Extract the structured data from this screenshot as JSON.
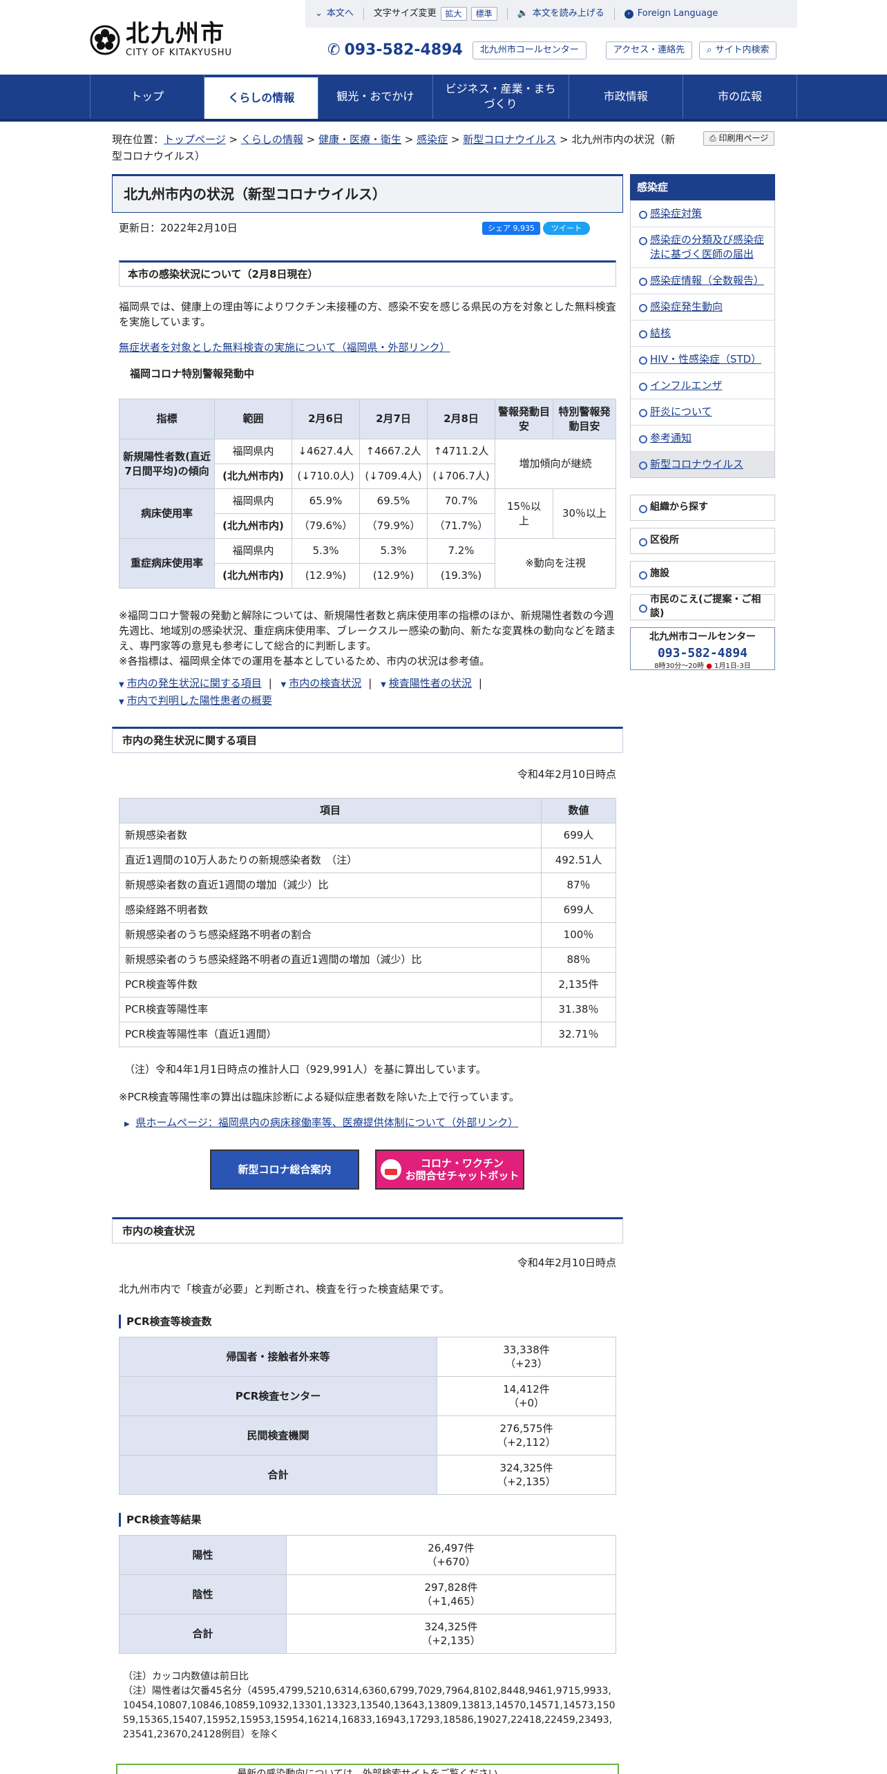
{
  "header": {
    "logo_ja": "北九州市",
    "logo_en": "CITY OF KITAKYUSHU",
    "util": {
      "skip": "本文へ",
      "fontsize_label": "文字サイズ変更",
      "enlarge": "拡大",
      "standard": "標準",
      "read_aloud": "本文を読み上げる",
      "foreign": "Foreign Language"
    },
    "tel": "093-582-4894",
    "call_center": "北九州市コールセンター",
    "access": "アクセス・連絡先",
    "search": "サイト内検索"
  },
  "gnav": [
    {
      "label": "トップ"
    },
    {
      "label": "くらしの情報"
    },
    {
      "label": "観光・おでかけ"
    },
    {
      "label": "ビジネス・産業・まちづくり"
    },
    {
      "label": "市政情報"
    },
    {
      "label": "市の広報"
    }
  ],
  "breadcrumb": {
    "prefix": "現在位置：",
    "items": [
      "トップページ",
      "くらしの情報",
      "健康・医療・衛生",
      "感染症",
      "新型コロナウイルス"
    ],
    "current": "北九州市内の状況（新型コロナウイルス）"
  },
  "print": "印刷用ページ",
  "title": "北九州市内の状況（新型コロナウイルス）",
  "updated": "更新日：2022年2月10日",
  "share": {
    "fb": "シェア 9,935",
    "tw": "ツイート"
  },
  "section1": {
    "heading": "本市の感染状況について（2月8日現在）",
    "para": "福岡県では、健康上の理由等によりワクチン未接種の方、感染不安を感じる県民の方を対象とした無料検査を実施しています。",
    "link": "無症状者を対象とした無料検査の実施について（福岡県・外部リンク）",
    "alert": "福岡コロナ特別警報発動中"
  },
  "table1": {
    "headers": [
      "指標",
      "範囲",
      "2月6日",
      "2月7日",
      "2月8日",
      "警報発動目安",
      "特別警報発動目安"
    ],
    "rows": [
      {
        "label": "新規陽性者数(直近7日間平均)の傾向",
        "a_range": "福岡県内",
        "a": [
          "↓4627.4人",
          "↑4667.2人",
          "↑4711.2人"
        ],
        "b_range": "(北九州市内)",
        "b": [
          "(↓710.0人)",
          "(↓709.4人)",
          "(↓706.7人)"
        ],
        "alert": "増加傾向が継続"
      },
      {
        "label": "病床使用率",
        "a_range": "福岡県内",
        "a": [
          "65.9%",
          "69.5%",
          "70.7%"
        ],
        "b_range": "(北九州市内)",
        "b": [
          "（79.6%）",
          "（79.9%）",
          "（71.7%）"
        ],
        "warn": "15％以上",
        "special": "30％以上"
      },
      {
        "label": "重症病床使用率",
        "a_range": "福岡県内",
        "a": [
          "5.3%",
          "5.3%",
          "7.2%"
        ],
        "b_range": "(北九州市内)",
        "b": [
          "(12.9%)",
          "(12.9%)",
          "(19.3%)"
        ],
        "alert": "※動向を注視"
      }
    ]
  },
  "notes1": "※福岡コロナ警報の発動と解除については、新規陽性者数と病床使用率の指標のほか、新規陽性者数の今週先週比、地域別の感染状況、重症病床使用率、ブレークスルー感染の動向、新たな変異株の動向などを踏まえ、専門家等の意見も参考にして総合的に判断します。",
  "notes2": "※各指標は、福岡県全体での運用を基本としているため、市内の状況は参考値。",
  "anchors": [
    "市内の発生状況に関する項目",
    "市内の検査状況",
    "検査陽性者の状況",
    "市内で判明した陽性患者の概要"
  ],
  "section2": {
    "heading": "市内の発生状況に関する項目",
    "date": "令和4年2月10日時点",
    "headers": [
      "項目",
      "数値"
    ],
    "rows": [
      [
        "新規感染者数",
        "699人"
      ],
      [
        "直近1週間の10万人あたりの新規感染者数　（注）",
        "492.51人"
      ],
      [
        "新規感染者数の直近1週間の増加（減少）比",
        "87％"
      ],
      [
        "感染経路不明者数",
        "699人"
      ],
      [
        "新規感染者のうち感染経路不明者の割合",
        "100％"
      ],
      [
        "新規感染者のうち感染経路不明者の直近1週間の増加（減少）比",
        "88％"
      ],
      [
        "PCR検査等件数",
        "2,135件"
      ],
      [
        "PCR検査等陽性率",
        "31.38％"
      ],
      [
        "PCR検査等陽性率（直近1週間）",
        "32.71％"
      ]
    ],
    "note1": "（注）令和4年1月1日時点の推計人口（929,991人）を基に算出しています。",
    "note2": "※PCR検査等陽性率の算出は臨床診断による疑似症患者数を除いた上で行っています。",
    "link": "県ホームページ：福岡県内の病床稼働率等、医療提供体制について（外部リンク）"
  },
  "banners": {
    "b1": "新型コロナ総合案内",
    "b2a": "コロナ・ワクチン",
    "b2b": "お問合せチャットボット"
  },
  "section3": {
    "heading": "市内の検査状況",
    "date": "令和4年2月10日時点",
    "intro": "北九州市内で「検査が必要」と判断され、検査を行った検査結果です。",
    "h_count": "PCR検査等検査数",
    "count_rows": [
      {
        "label": "帰国者・接触者外来等",
        "v1": "33,338件",
        "v2": "（+23）"
      },
      {
        "label": "PCR検査センター",
        "v1": "14,412件",
        "v2": "（+0）"
      },
      {
        "label": "民間検査機関",
        "v1": "276,575件",
        "v2": "（+2,112）"
      },
      {
        "label": "合計",
        "v1": "324,325件",
        "v2": "（+2,135）"
      }
    ],
    "h_result": "PCR検査等結果",
    "result_rows": [
      {
        "label": "陽性",
        "v1": "26,497件",
        "v2": "（+670）"
      },
      {
        "label": "陰性",
        "v1": "297,828件",
        "v2": "（+1,465）"
      },
      {
        "label": "合計",
        "v1": "324,325件",
        "v2": "（+2,135）"
      }
    ],
    "note1": "（注）カッコ内数値は前日比",
    "note2": "（注）陽性者は欠番45名分（4595,4799,5210,6314,6360,6799,7029,7964,8102,8448,9461,9715,9933,10454,10807,10846,10859,10932,13301,13323,13540,13643,13809,13813,14570,14571,14573,15059,15365,15407,15952,15953,15954,16214,16833,16943,17293,18586,19027,22418,22459,23493,23541,23670,24128例目）を除く"
  },
  "green_box": "最新の感染動向については、外部検索サイトをご覧ください",
  "side": {
    "title": "感染症",
    "items": [
      "感染症対策",
      "感染症の分類及び感染症法に基づく医師の届出",
      "感染症情報（全数報告）",
      "感染症発生動向",
      "結核",
      "HIV・性感染症（STD）",
      "インフルエンザ",
      "肝炎について",
      "参考通知",
      "新型コロナウイルス"
    ],
    "buttons": [
      "組織から探す",
      "区役所",
      "施設",
      "市民のこえ(ご提案・ご相談)"
    ],
    "banner": {
      "title": "北九州市コールセンター",
      "tel": "093-582-4894",
      "hours": "8時30分〜20時",
      "closed": "1月1日-3日"
    }
  }
}
